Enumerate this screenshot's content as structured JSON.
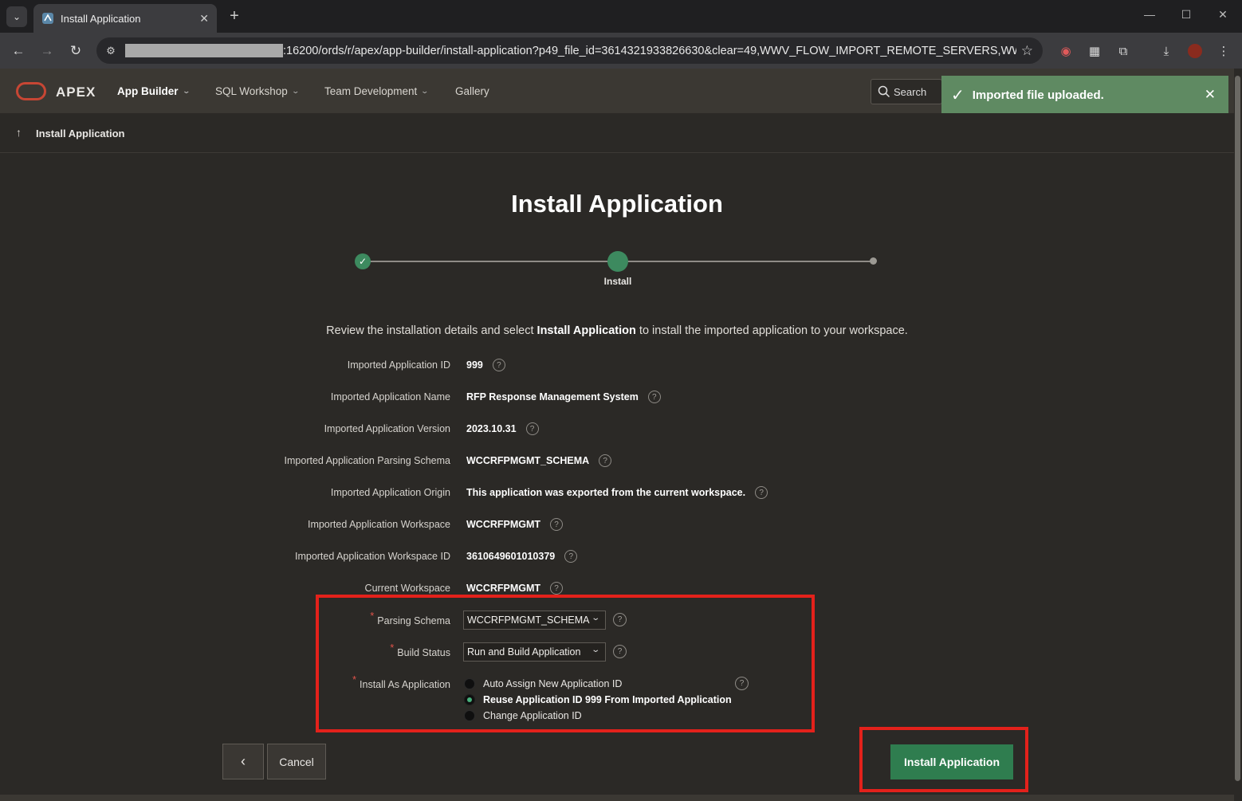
{
  "browser": {
    "tab_title": "Install Application",
    "url": ":16200/ords/r/apex/app-builder/install-application?p49_file_id=3614321933826630&clear=49,WWV_FLOW_IMPORT_REMOTE_SERVERS,WWV_FLO..."
  },
  "header": {
    "brand": "APEX",
    "nav": [
      {
        "label": "App Builder"
      },
      {
        "label": "SQL Workshop"
      },
      {
        "label": "Team Development"
      },
      {
        "label": "Gallery"
      }
    ],
    "search_label": "Search"
  },
  "toast": {
    "message": "Imported file uploaded."
  },
  "breadcrumb": {
    "label": "Install Application"
  },
  "page": {
    "title": "Install Application",
    "wizard_step_label": "Install",
    "intro_before": "Review the installation details and select ",
    "intro_bold": "Install Application",
    "intro_after": " to install the imported application to your workspace."
  },
  "details": [
    {
      "label": "Imported Application ID",
      "value": "999"
    },
    {
      "label": "Imported Application Name",
      "value": "RFP Response Management System"
    },
    {
      "label": "Imported Application Version",
      "value": "2023.10.31"
    },
    {
      "label": "Imported Application Parsing Schema",
      "value": "WCCRFPMGMT_SCHEMA"
    },
    {
      "label": "Imported Application Origin",
      "value": "This application was exported from the current workspace."
    },
    {
      "label": "Imported Application Workspace",
      "value": "WCCRFPMGMT"
    },
    {
      "label": "Imported Application Workspace ID",
      "value": "3610649601010379"
    },
    {
      "label": "Current Workspace",
      "value": "WCCRFPMGMT"
    }
  ],
  "form": {
    "parsing_schema_label": "Parsing Schema",
    "parsing_schema_value": "WCCRFPMGMT_SCHEMA",
    "build_status_label": "Build Status",
    "build_status_value": "Run and Build Application",
    "install_as_label": "Install As Application",
    "install_as_options": [
      {
        "label": "Auto Assign New Application ID"
      },
      {
        "label": "Reuse Application ID 999 From Imported Application"
      },
      {
        "label": "Change Application ID"
      }
    ],
    "required_mark": "*"
  },
  "buttons": {
    "back": "‹",
    "cancel": "Cancel",
    "install": "Install Application"
  },
  "colors": {
    "accent_green": "#2f7d4f",
    "highlight_red": "#e3211b",
    "brand_red": "#c74634"
  }
}
